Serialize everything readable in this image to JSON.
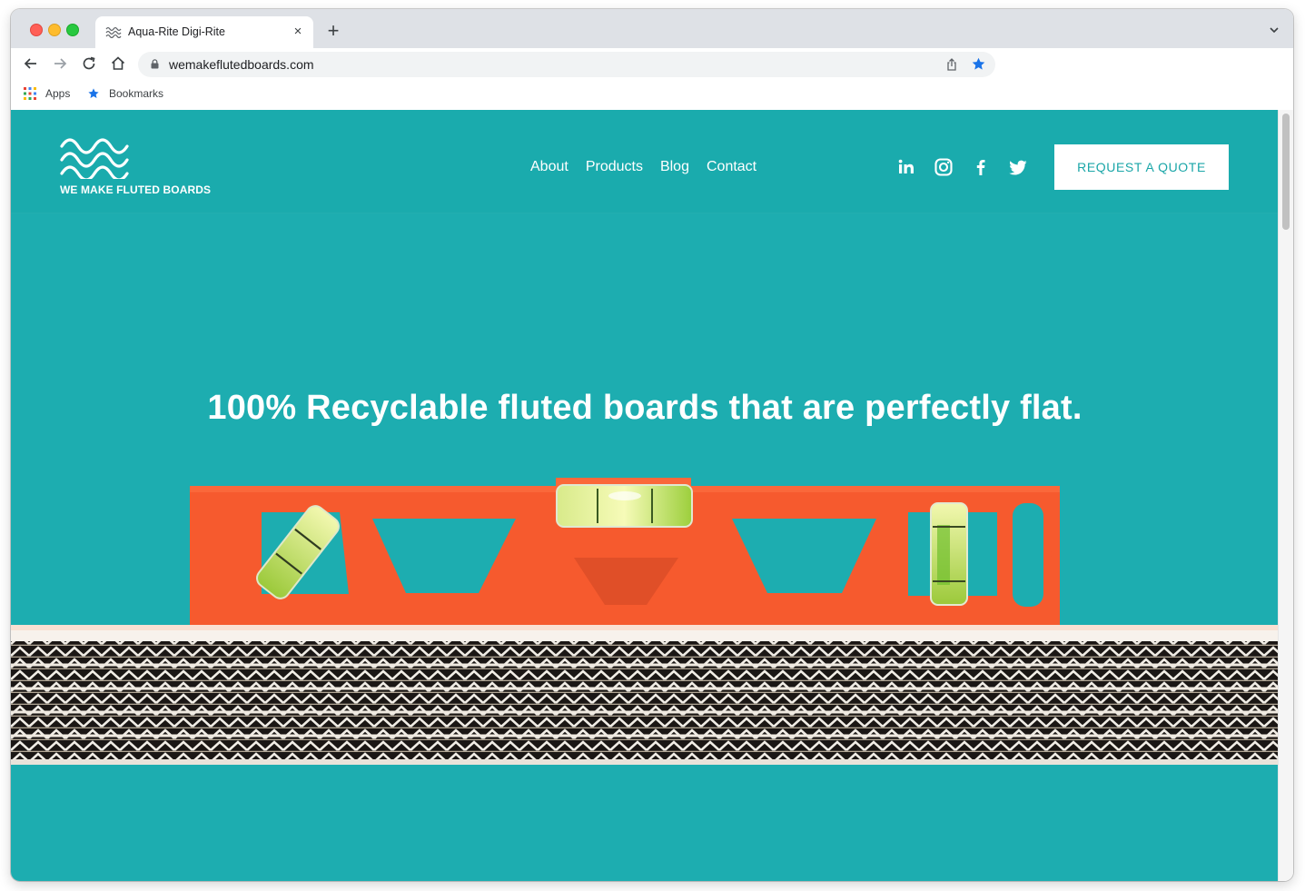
{
  "browser": {
    "tab_title": "Aqua-Rite Digi-Rite",
    "tab_close": "×",
    "new_tab": "+",
    "url": "wemakeflutedboards.com",
    "bookmarks": [
      {
        "label": "Apps",
        "icon": "apps-grid-icon"
      },
      {
        "label": "Bookmarks",
        "icon": "star-icon"
      }
    ]
  },
  "site": {
    "logo_text": "WE MAKE FLUTED BOARDS",
    "nav": [
      "About",
      "Products",
      "Blog",
      "Contact"
    ],
    "social": [
      "linkedin-icon",
      "instagram-icon",
      "facebook-icon",
      "twitter-icon"
    ],
    "cta": "REQUEST A QUOTE",
    "hero_heading": "100% Recyclable fluted boards that are perfectly flat."
  },
  "colors": {
    "page_bg": "#1dadb0",
    "header_bg": "#1aabad",
    "cta_text": "#1aa6a8",
    "level_orange": "#f65a2e",
    "bookmark_star": "#1a73e8"
  }
}
